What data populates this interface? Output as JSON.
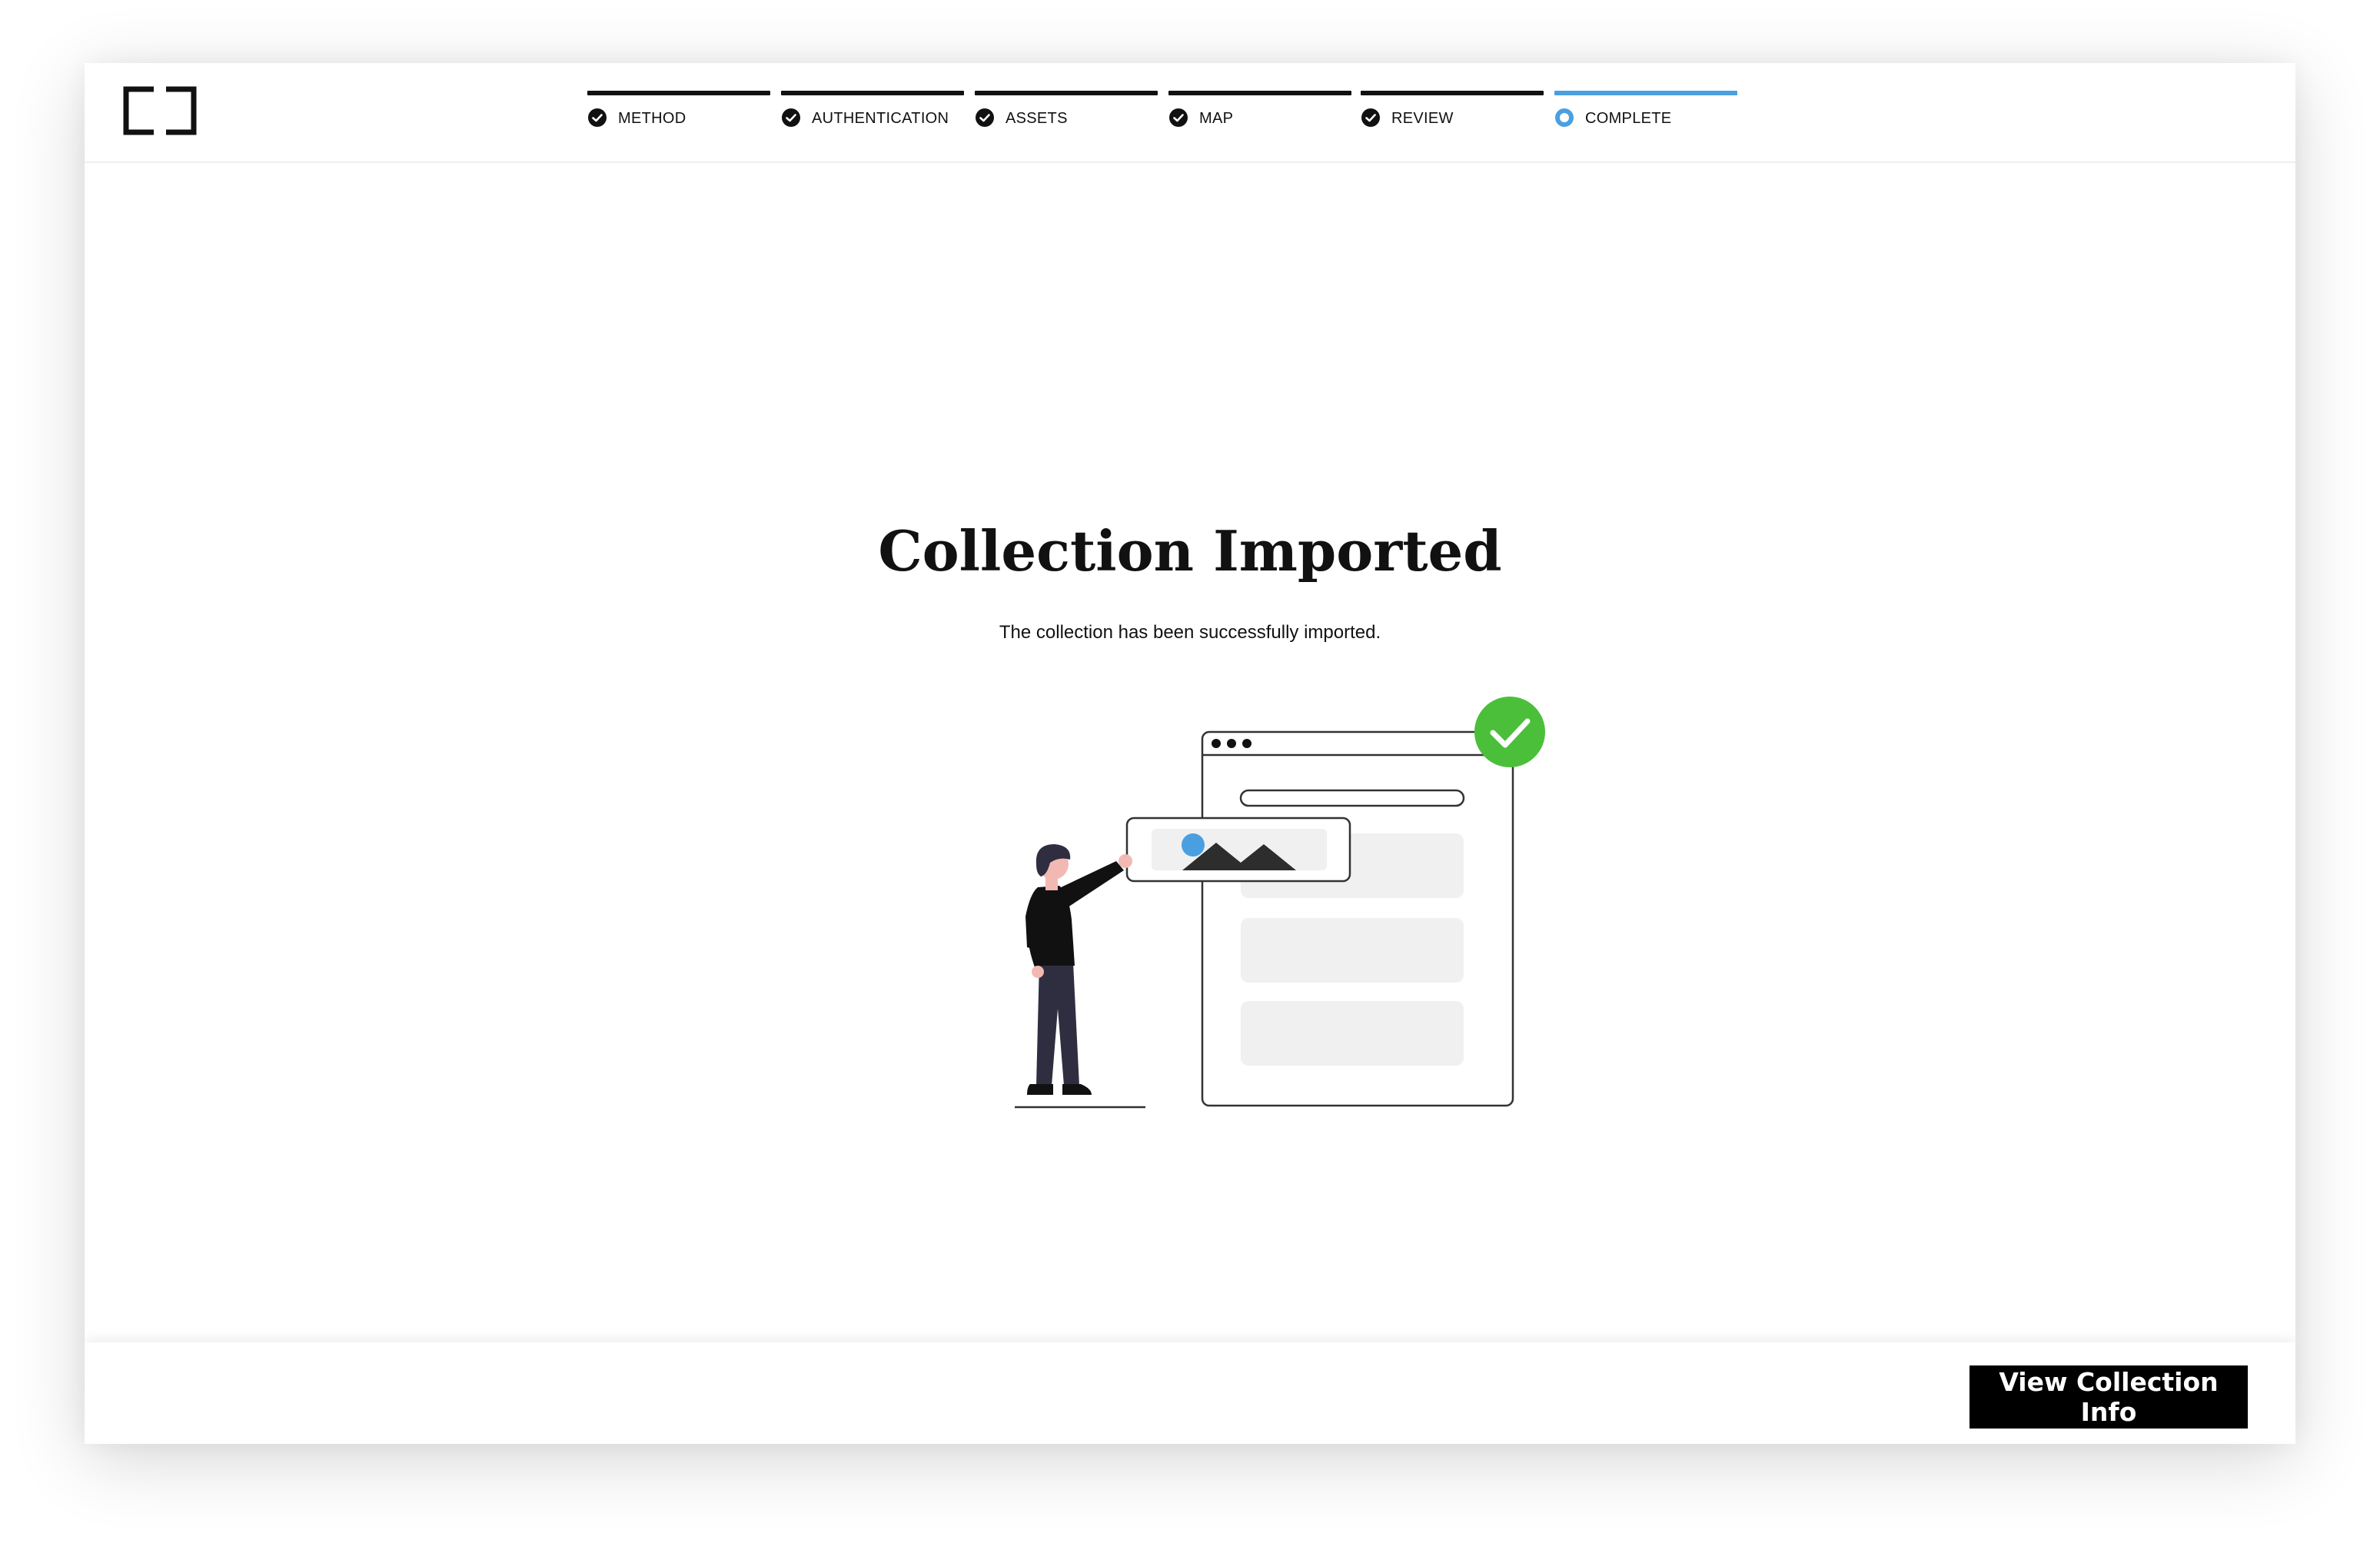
{
  "app": {
    "logo_icon": "bracket-logo-icon"
  },
  "stepper": {
    "steps": [
      {
        "label": "METHOD",
        "status": "complete",
        "icon": "check-circle-icon"
      },
      {
        "label": "AUTHENTICATION",
        "status": "complete",
        "icon": "check-circle-icon"
      },
      {
        "label": "ASSETS",
        "status": "complete",
        "icon": "check-circle-icon"
      },
      {
        "label": "MAP",
        "status": "complete",
        "icon": "check-circle-icon"
      },
      {
        "label": "REVIEW",
        "status": "complete",
        "icon": "check-circle-icon"
      },
      {
        "label": "COMPLETE",
        "status": "current",
        "icon": "ring-circle-icon"
      }
    ],
    "colors": {
      "complete": "#111111",
      "current": "#4a9fe0"
    }
  },
  "main": {
    "title": "Collection Imported",
    "subtitle": "The collection has been successfully imported.",
    "illustration": {
      "icon": "import-success-illustration",
      "success_color": "#4bbf3a",
      "accent_color": "#4a9fe0"
    }
  },
  "footer": {
    "primary_button_label": "View Collection Info"
  }
}
